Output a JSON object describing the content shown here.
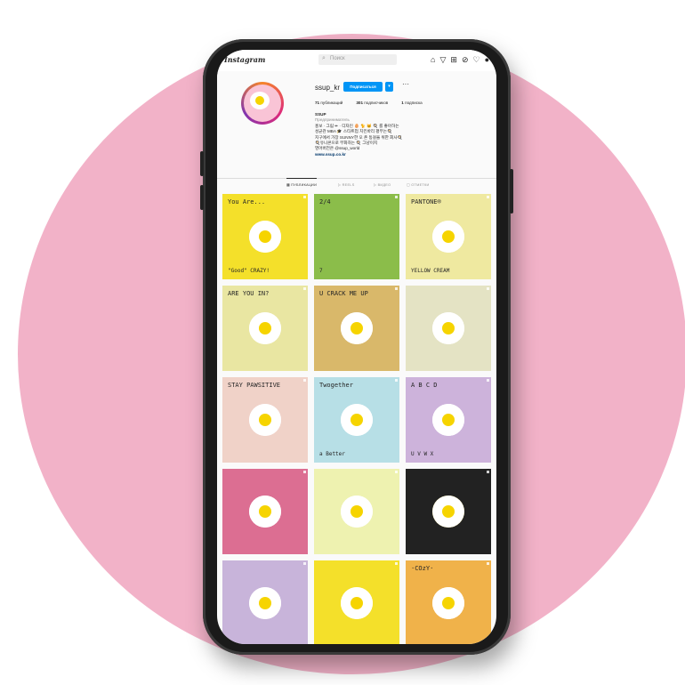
{
  "topbar": {
    "logo": "Instagram",
    "search_placeholder": "Поиск",
    "icons": [
      "home-icon",
      "direct-icon",
      "new-post-icon",
      "explore-icon",
      "heart-icon",
      "profile-icon"
    ]
  },
  "profile": {
    "username": "ssup_kr",
    "follow_label": "Подписаться",
    "dropdown_glyph": "▾",
    "more_glyph": "···",
    "stats": {
      "posts": "71",
      "posts_label": "публикаций",
      "followers": "301",
      "followers_label": "подписчиков",
      "following": "1",
      "following_label": "подписка"
    },
    "bio": {
      "name": "SSUP",
      "category": "Предприниматель",
      "line1": "홍보 · 그림 ✏ · 디자인 🥚 🐈 🐱 🍳 를 좋아하는",
      "line2": "성균관 MBA 🎓 스타트업 치킨바리 평무는🍳",
      "line3": "지구에서 가장 SUNNY한 오 존 동걸을 위한 회사🍳",
      "line4": "🍳유니콘으로 부화하는 🍳 그냥이지",
      "line5": "영어버전은 @ssup_world",
      "link": "www.ssup.co.kr"
    }
  },
  "tabs": [
    "▦ ПУБЛИКАЦИИ",
    "▷ REELS",
    "▷ ВИДЕО",
    "▢ ОТМЕТКИ"
  ],
  "posts": [
    {
      "bg": "#f4e02a",
      "text": "You Are...",
      "text2": "\"Good\" CRAZY!"
    },
    {
      "bg": "#8bbd4a",
      "text": "2/4",
      "text2": "7"
    },
    {
      "bg": "#efe9a0",
      "text": "PANTONE®",
      "text2": "YELLOW CREAM"
    },
    {
      "bg": "#e9e6a2",
      "text": "ARE YOU IN?",
      "text2": ""
    },
    {
      "bg": "#d9b86a",
      "text": "U CRACK ME UP",
      "text2": ""
    },
    {
      "bg": "#e4e3c4",
      "text": "",
      "text2": ""
    },
    {
      "bg": "#f0d2c8",
      "text": "STAY PAWSITIVE",
      "text2": ""
    },
    {
      "bg": "#b7dfe6",
      "text": "Twogether",
      "text2": "a Better"
    },
    {
      "bg": "#cdb3db",
      "text": "A B C D",
      "text2": "U V W X"
    },
    {
      "bg": "#dc6e92",
      "text": "",
      "text2": ""
    },
    {
      "bg": "#eef2b0",
      "text": "",
      "text2": ""
    },
    {
      "bg": "#222222",
      "text": "",
      "text2": ""
    },
    {
      "bg": "#c8b4da",
      "text": "",
      "text2": ""
    },
    {
      "bg": "#f4e02a",
      "text": "",
      "text2": ""
    },
    {
      "bg": "#f0b24a",
      "text": "·COzY·",
      "text2": ""
    }
  ]
}
